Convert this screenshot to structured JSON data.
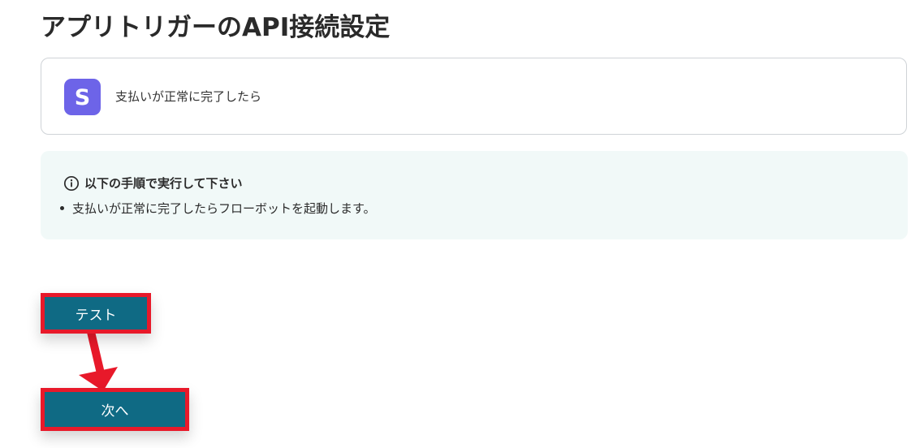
{
  "page": {
    "title": "アプリトリガーのAPI接続設定"
  },
  "app_card": {
    "icon": "stripe-s-icon",
    "icon_letter": "S",
    "icon_color": "#6d64e8",
    "event_label": "支払いが正常に完了したら"
  },
  "info_box": {
    "icon": "info-circle-icon",
    "title": "以下の手順で実行して下さい",
    "items": [
      "支払いが正常に完了したらフローボットを起動します。"
    ],
    "background": "#f1f9f8"
  },
  "buttons": {
    "test_label": "テスト",
    "next_label": "次へ",
    "color": "#0f6a84"
  },
  "annotation": {
    "highlight_color": "#e8192a",
    "arrow": "from test button to next button"
  }
}
